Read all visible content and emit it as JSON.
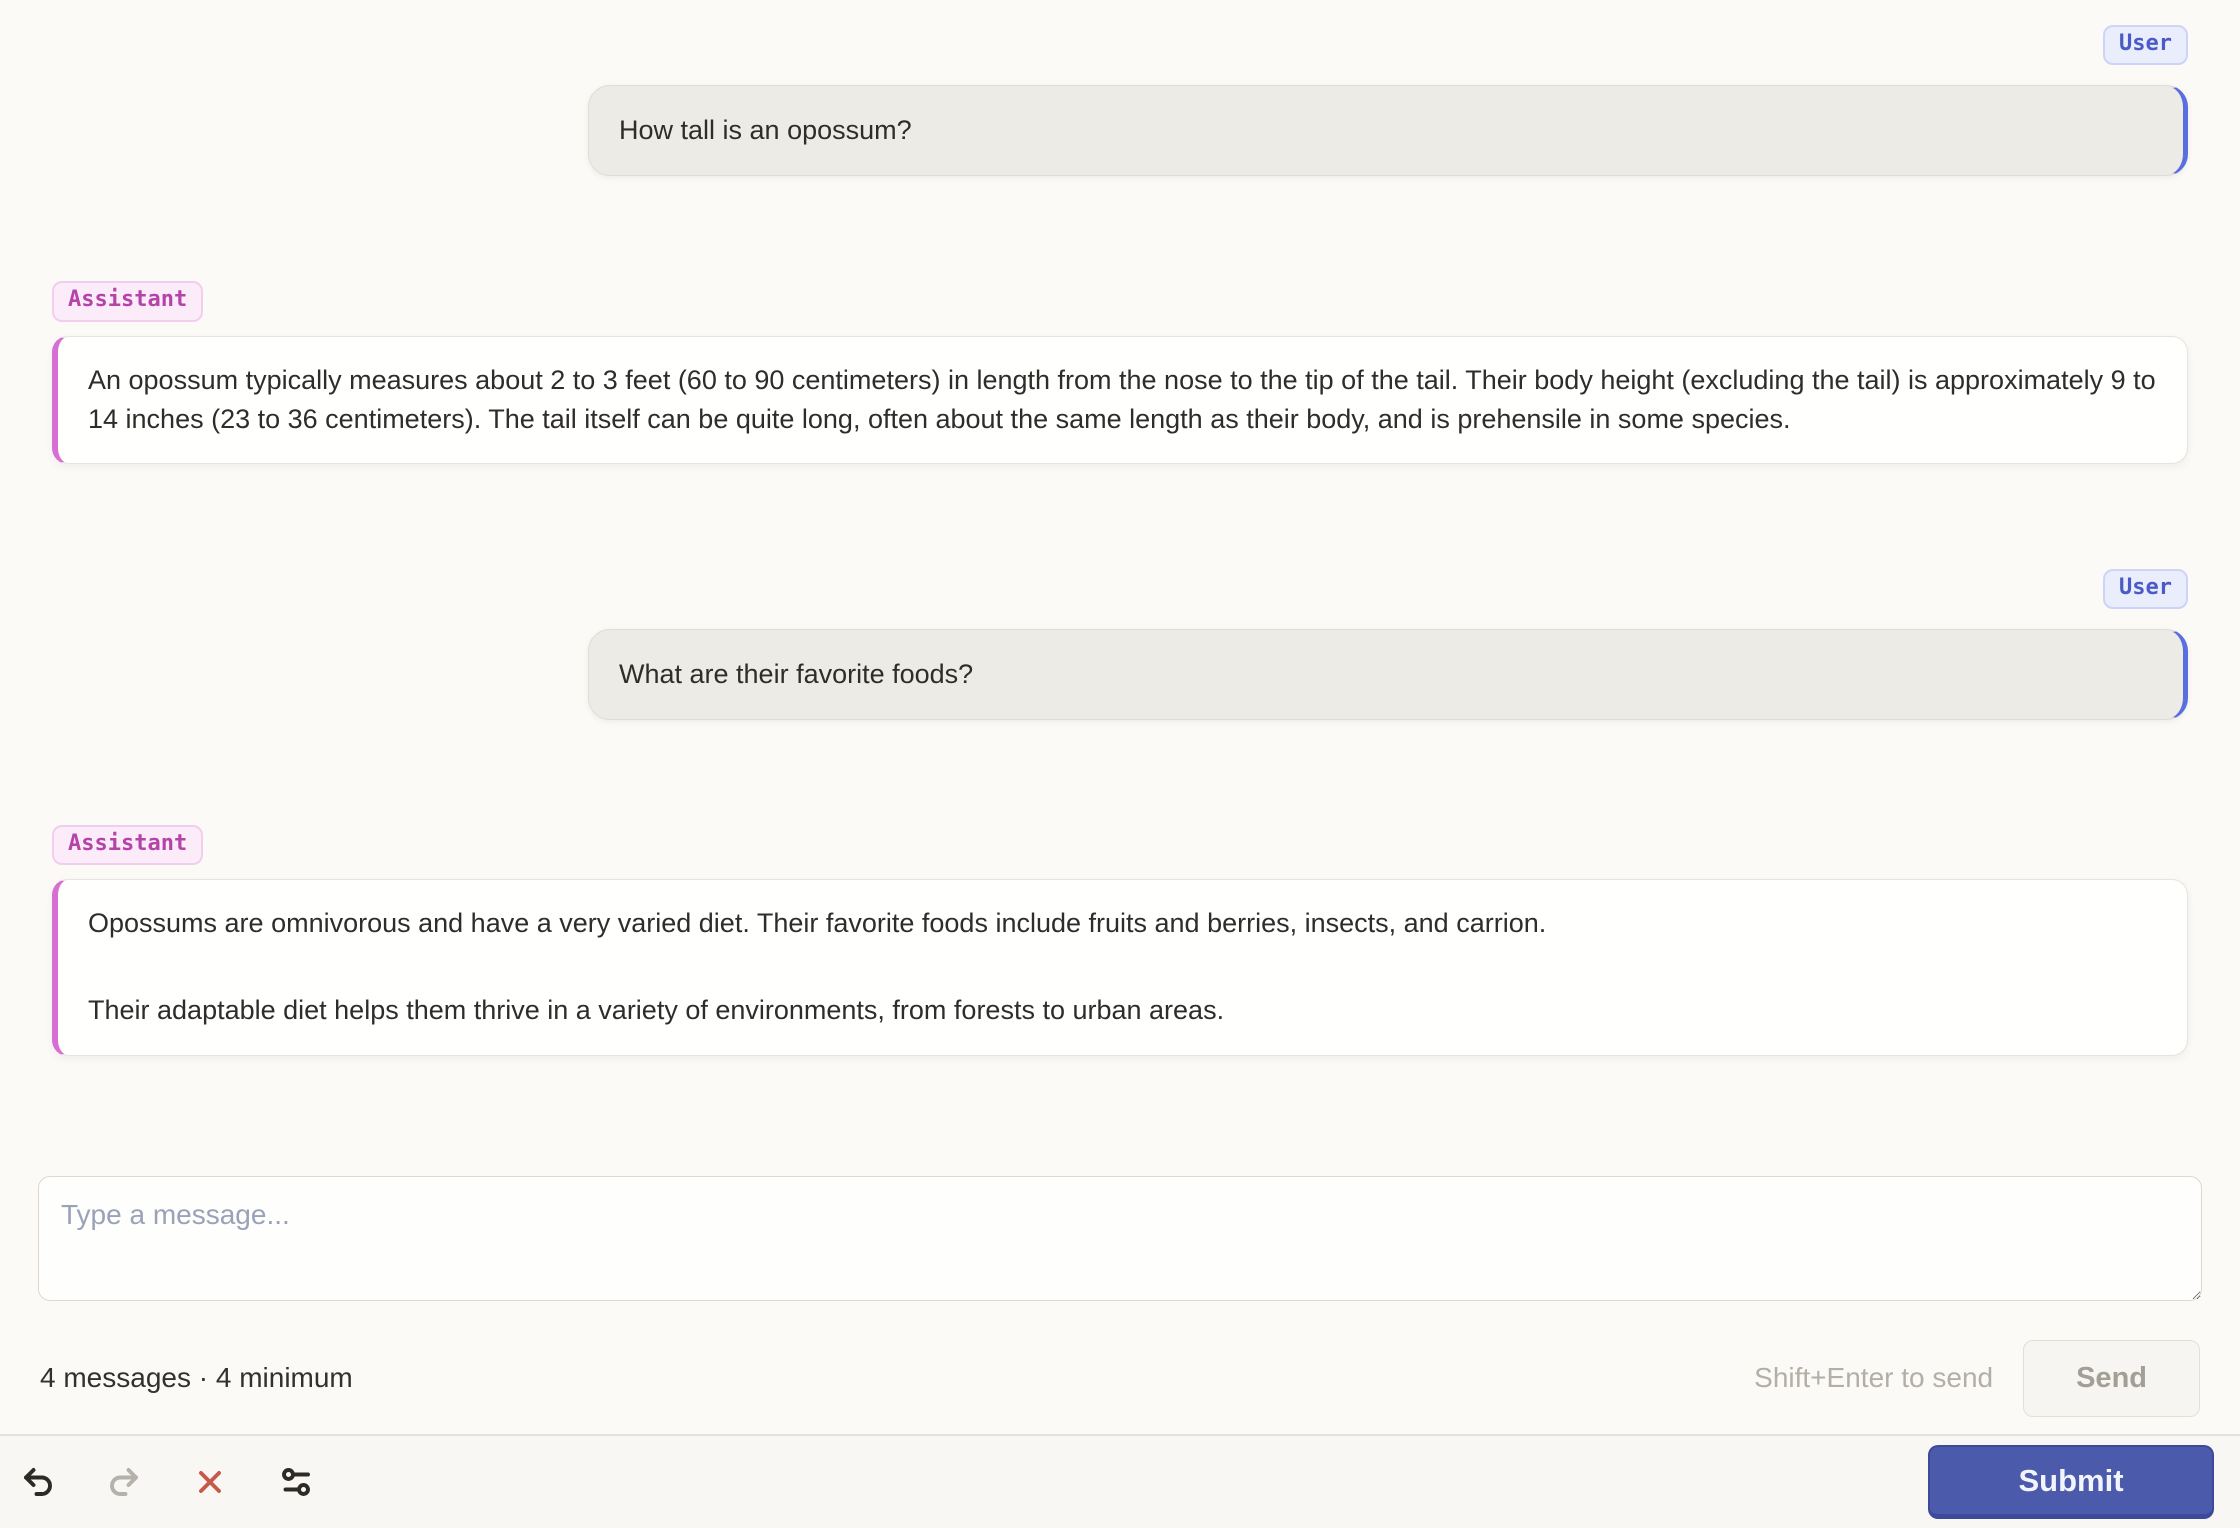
{
  "messages": [
    {
      "role": "User",
      "text": "How tall is an opossum?"
    },
    {
      "role": "Assistant",
      "text": "An opossum typically measures about 2 to 3 feet (60 to 90 centimeters) in length from the nose to the tip of the tail. Their body height (excluding the tail) is approximately 9 to 14 inches (23 to 36 centimeters). The tail itself can be quite long, often about the same length as their body, and is prehensile in some species."
    },
    {
      "role": "User",
      "text": "What are their favorite foods?"
    },
    {
      "role": "Assistant",
      "paragraphs": [
        "Opossums are omnivorous and have a very varied diet. Their favorite foods include fruits and berries, insects, and carrion.",
        "Their adaptable diet helps them thrive in a variety of environments, from forests to urban areas."
      ]
    }
  ],
  "composer": {
    "placeholder": "Type a message...",
    "status": "4 messages · 4 minimum",
    "hint": "Shift+Enter to send",
    "send_label": "Send"
  },
  "toolbar": {
    "undo_icon": "undo-arrow",
    "redo_icon": "redo-arrow",
    "discard_icon": "x-mark",
    "settings_icon": "sliders",
    "submit_label": "Submit"
  },
  "colors": {
    "page_background": "#fbfaf7",
    "user_accent": "#5b6ee0",
    "user_badge_text": "#4a5bc7",
    "user_badge_background": "#e9edfc",
    "user_bubble_background": "#edebe6",
    "assistant_accent": "#d76ed2",
    "assistant_badge_text": "#b544a8",
    "assistant_badge_background": "#fcebf9",
    "submit_background": "#4c5aac",
    "discard_red": "#c7594b"
  }
}
